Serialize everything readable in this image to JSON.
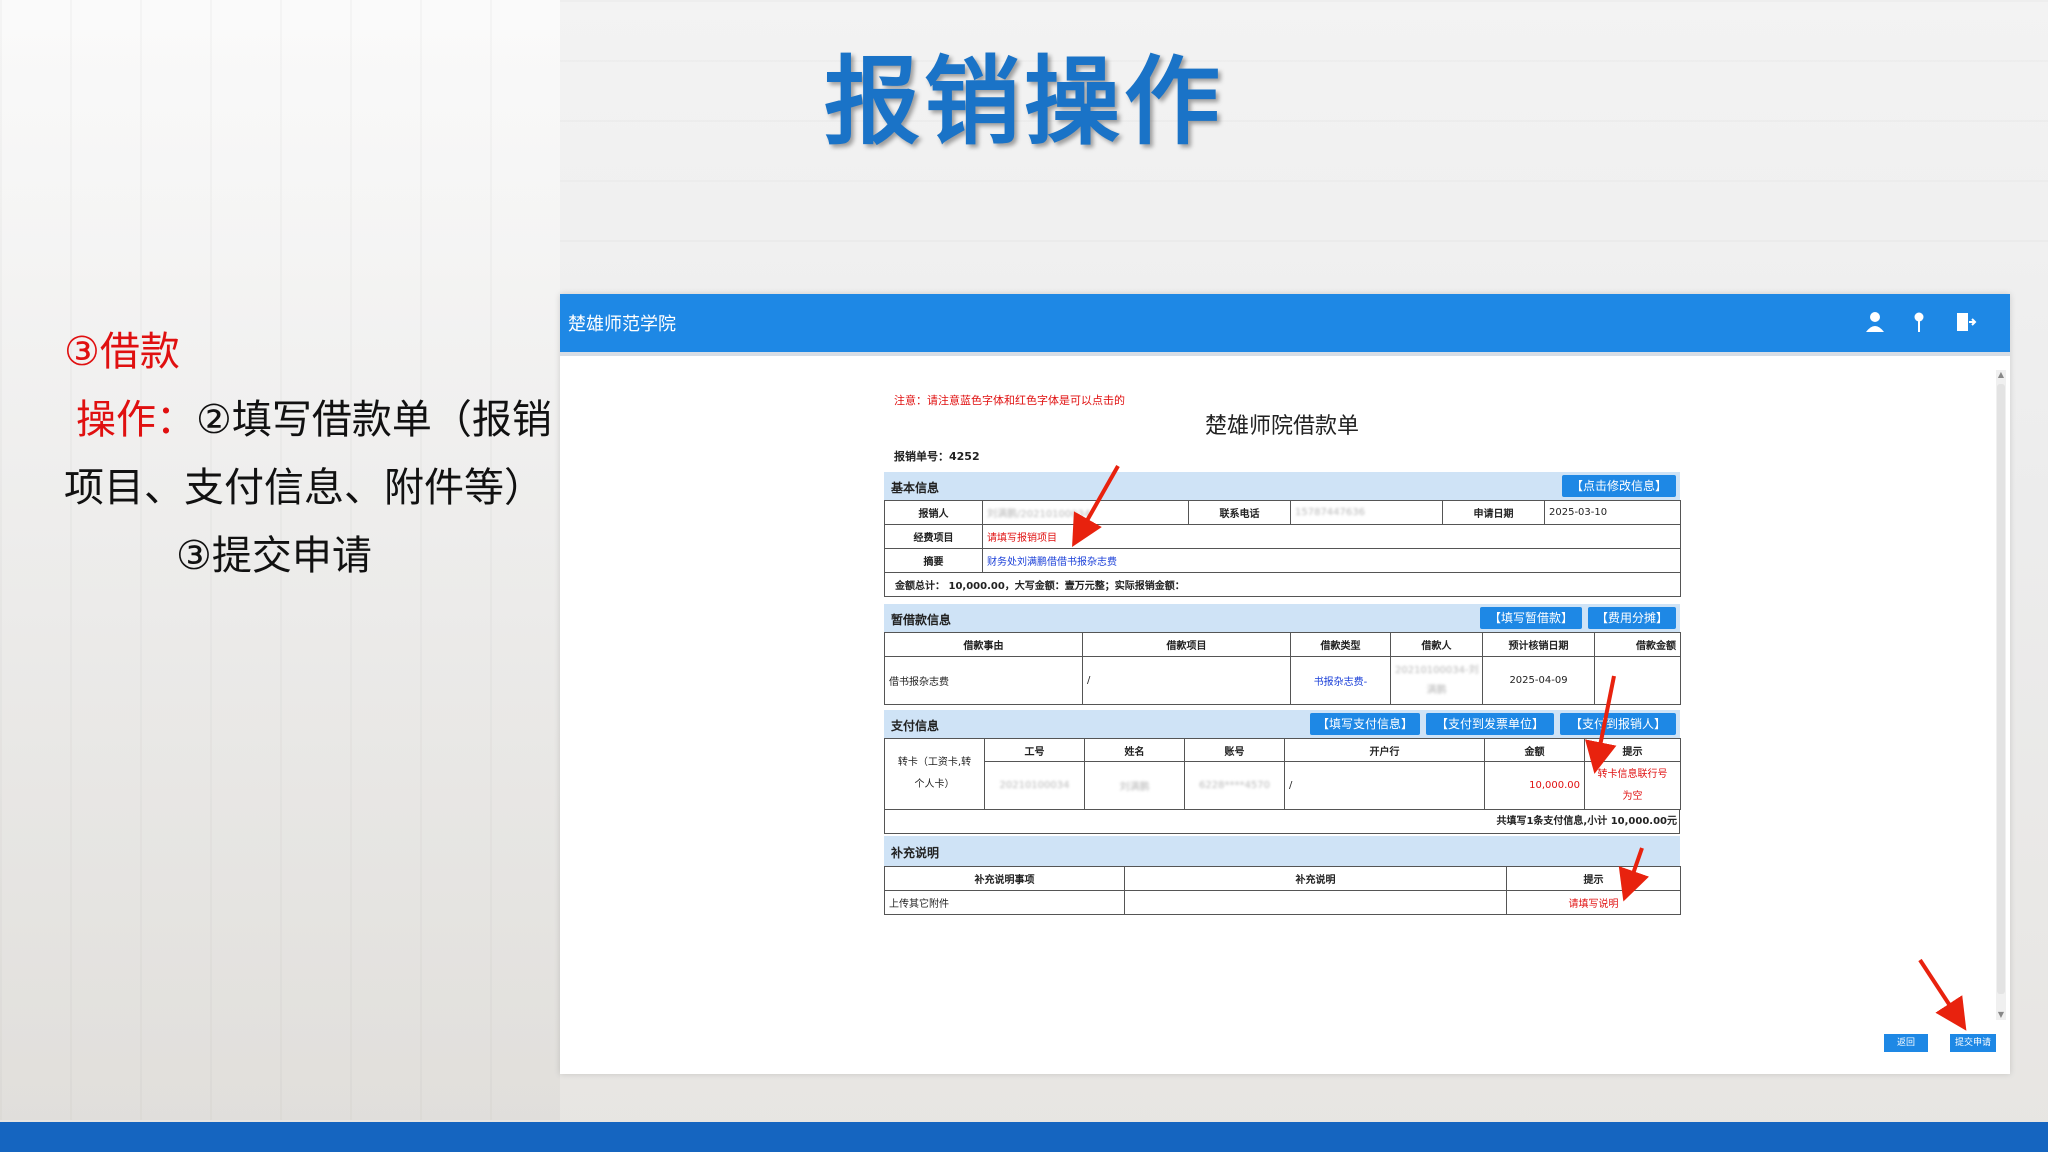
{
  "slide": {
    "title": "报销操作",
    "side": {
      "step": "③借款",
      "op_label": "操作：",
      "op_text_a": "②填写借款单（报销",
      "op_text_b": "项目、支付信息、附件等）",
      "op_text_c": "③提交申请"
    }
  },
  "app": {
    "name": "楚雄师范学院",
    "icons": [
      "user-icon",
      "location-pin-icon",
      "logout-icon"
    ]
  },
  "form": {
    "notice": "注意：请注意蓝色字体和红色字体是可以点击的",
    "title": "楚雄师院借款单",
    "doc_no": "报销单号：4252",
    "basic": {
      "section": "基本信息",
      "edit_btn": "【点击修改信息】",
      "applicant_label": "报销人",
      "applicant_value": "刘满鹏/20210100034",
      "phone_label": "联系电话",
      "phone_value": "15787447636",
      "date_label": "申请日期",
      "date_value": "2025-03-10",
      "project_label": "经费项目",
      "project_value": "请填写报销项目",
      "summary_label": "摘要",
      "summary_value": "财务处刘满鹏借借书报杂志费",
      "total_text": "金额总计：  10,000.00，大写金额：壹万元整；实际报销金额："
    },
    "loan": {
      "section": "暂借款信息",
      "btn_fill": "【填写暂借款】",
      "btn_split": "【费用分摊】",
      "headers": [
        "借款事由",
        "借款项目",
        "借款类型",
        "借款人",
        "预计核销日期",
        "借款金额"
      ],
      "row": {
        "reason": "借书报杂志费",
        "project": "/",
        "type": "书报杂志费-",
        "person_a": "20210100034-刘",
        "person_b": "满鹏",
        "date": "2025-04-09",
        "amount": ""
      }
    },
    "pay": {
      "section": "支付信息",
      "btn_fill": "【填写支付信息】",
      "btn_invoice": "【支付到发票单位】",
      "btn_person": "【支付到报销人】",
      "headers": [
        "工号",
        "姓名",
        "账号",
        "开户行",
        "金额",
        "提示"
      ],
      "row": {
        "method_a": "转卡（工资卡,转",
        "method_b": "个人卡）",
        "id": "20210100034",
        "name": "刘满鹏",
        "account": "6228****4570",
        "bank": "/",
        "amount": "10,000.00",
        "hint_a": "转卡信息联行号",
        "hint_b": "为空"
      },
      "summary": "共填写1条支付信息,小计 10,000.00元"
    },
    "extra": {
      "section": "补充说明",
      "headers": [
        "补充说明事项",
        "补充说明",
        "提示"
      ],
      "row": {
        "item": "上传其它附件",
        "desc": "",
        "hint": "请填写说明"
      }
    },
    "footer": {
      "back": "返回",
      "submit": "提交申请"
    }
  },
  "colors": {
    "brand": "#1e88e5",
    "title": "#1a73c7",
    "alert": "#e01010",
    "link": "#1a3fd8",
    "section_bg": "#cfe3f6"
  }
}
